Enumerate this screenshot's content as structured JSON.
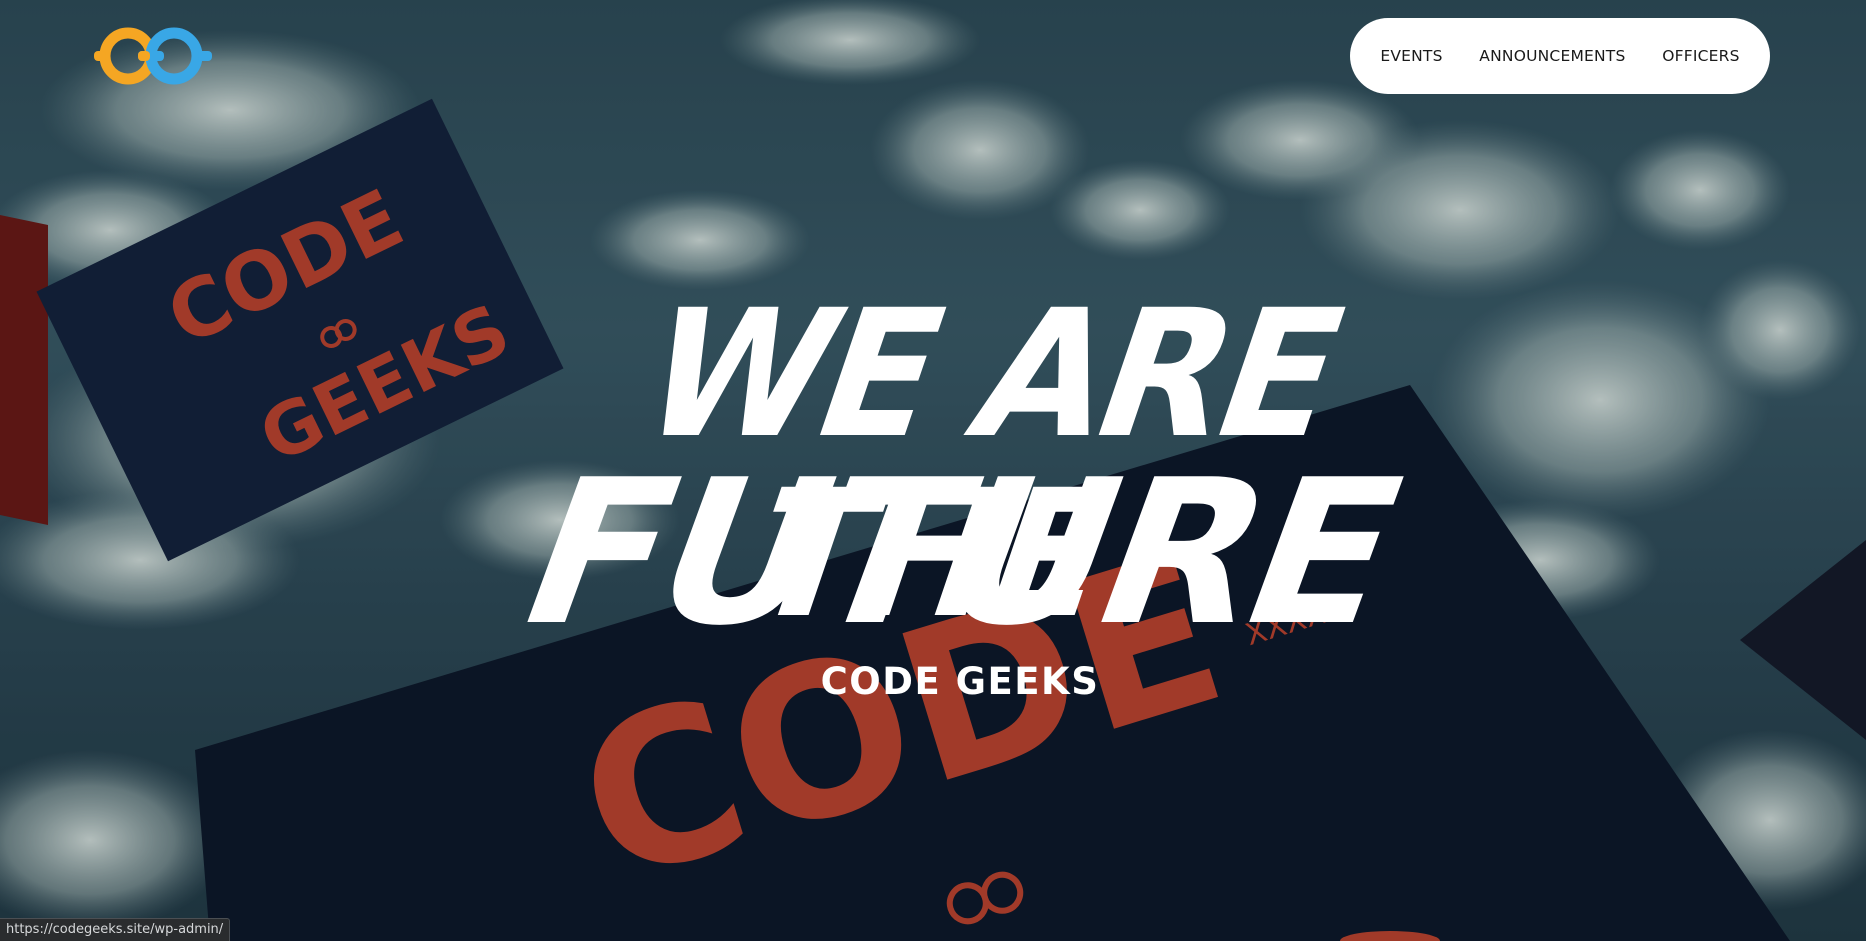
{
  "site": {
    "logo_icon": "code-geeks-logo",
    "brand_colors": {
      "orange": "#f5a623",
      "blue": "#39a7e6"
    }
  },
  "nav": {
    "items": [
      {
        "label": "EVENTS"
      },
      {
        "label": "ANNOUNCEMENTS"
      },
      {
        "label": "OFFICERS"
      }
    ]
  },
  "hero": {
    "headline_line1": "WE ARE THE",
    "headline_line2": "FUTURE",
    "subtitle": "CODE GEEKS",
    "poster_text_code": "CODE",
    "poster_text_geeks": "GEEKS",
    "poster_marks": "XXXXX",
    "poster_accent_color": "#c2432b",
    "poster_bg_color": "#0f1a2b"
  },
  "status_bar": {
    "url": "https://codegeeks.site/wp-admin/"
  }
}
